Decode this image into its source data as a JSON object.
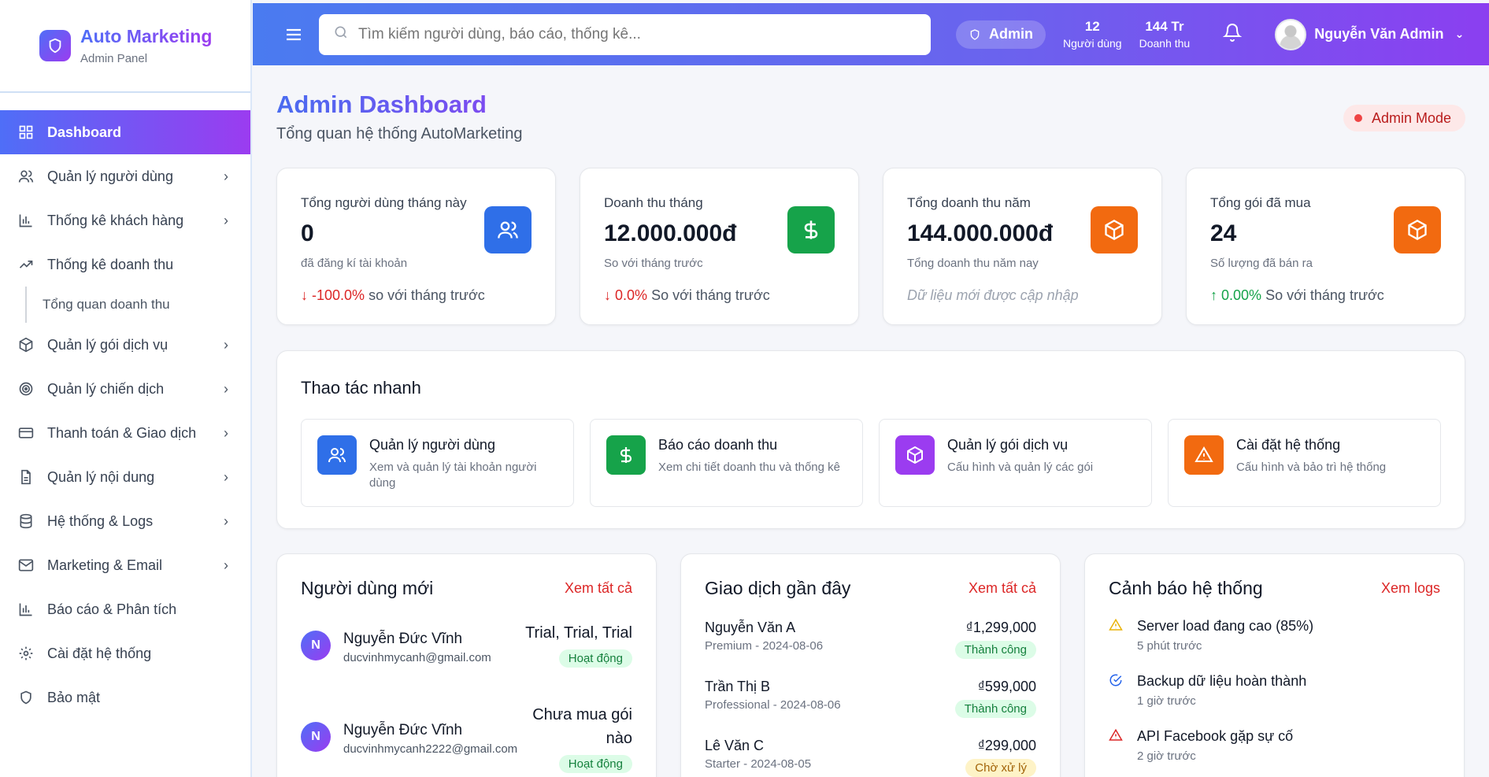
{
  "brand": {
    "title": "Auto Marketing",
    "subtitle": "Admin Panel"
  },
  "sidebar": {
    "items": [
      {
        "label": "Dashboard",
        "icon": "dashboard-icon",
        "active": true
      },
      {
        "label": "Quản lý người dùng",
        "icon": "users-icon"
      },
      {
        "label": "Thống kê khách hàng",
        "icon": "bar-chart-icon"
      },
      {
        "label": "Thống kê doanh thu",
        "icon": "trending-up-icon"
      },
      {
        "label": "Tổng quan doanh thu"
      },
      {
        "label": "Quản lý gói dịch vụ",
        "icon": "package-icon"
      },
      {
        "label": "Quản lý chiến dịch",
        "icon": "target-icon"
      },
      {
        "label": "Thanh toán & Giao dịch",
        "icon": "credit-card-icon"
      },
      {
        "label": "Quản lý nội dung",
        "icon": "document-icon"
      },
      {
        "label": "Hệ thống & Logs",
        "icon": "database-icon"
      },
      {
        "label": "Marketing & Email",
        "icon": "mail-icon"
      },
      {
        "label": "Báo cáo & Phân tích",
        "icon": "bar-chart-icon"
      },
      {
        "label": "Cài đặt hệ thống",
        "icon": "gear-icon"
      },
      {
        "label": "Bảo mật",
        "icon": "shield-icon"
      }
    ]
  },
  "topbar": {
    "search_placeholder": "Tìm kiếm người dùng, báo cáo, thống kê...",
    "role": "Admin",
    "users_value": "12",
    "users_label": "Người dùng",
    "revenue_value": "144 Tr",
    "revenue_label": "Doanh thu",
    "user_name": "Nguyễn Văn Admin"
  },
  "page": {
    "title": "Admin Dashboard",
    "subtitle": "Tổng quan hệ thống AutoMarketing",
    "mode": "Admin Mode"
  },
  "stats": [
    {
      "title": "Tổng người dùng tháng này",
      "value": "0",
      "sub": "đã đăng kí tài khoản",
      "change": "-100.0%",
      "change_text": "so với tháng trước",
      "icon": "users-icon"
    },
    {
      "title": "Doanh thu tháng",
      "value": "12.000.000đ",
      "sub": "So với tháng trước",
      "change": "0.0%",
      "change_text": "So với tháng trước",
      "icon": "dollar-icon"
    },
    {
      "title": "Tổng doanh thu năm",
      "value": "144.000.000đ",
      "sub": "Tổng doanh thu năm nay",
      "note": "Dữ liệu mới được cập nhập",
      "icon": "package-icon"
    },
    {
      "title": "Tổng gói đã mua",
      "value": "24",
      "sub": "Số lượng đã bán ra",
      "change": "0.00%",
      "change_text": "So với tháng trước",
      "icon": "package-icon"
    }
  ],
  "quick": {
    "title": "Thao tác nhanh",
    "items": [
      {
        "title": "Quản lý người dùng",
        "desc": "Xem và quản lý tài khoản người dùng",
        "icon": "users-icon"
      },
      {
        "title": "Báo cáo doanh thu",
        "desc": "Xem chi tiết doanh thu và thống kê",
        "icon": "dollar-icon"
      },
      {
        "title": "Quản lý gói dịch vụ",
        "desc": "Cấu hình và quản lý các gói",
        "icon": "package-icon"
      },
      {
        "title": "Cài đặt hệ thống",
        "desc": "Cấu hình và bảo trì hệ thống",
        "icon": "warning-icon"
      }
    ]
  },
  "new_users": {
    "title": "Người dùng mới",
    "link": "Xem tất cả",
    "rows": [
      {
        "initial": "N",
        "name": "Nguyễn Đức Vĩnh",
        "email": "ducvinhmycanh@gmail.com",
        "plan": "Trial, Trial, Trial",
        "status": "Hoạt động"
      },
      {
        "initial": "N",
        "name": "Nguyễn Đức Vĩnh",
        "email": "ducvinhmycanh2222@gmail.com",
        "plan": "Chưa mua gói nào",
        "status": "Hoạt động"
      }
    ]
  },
  "transactions": {
    "title": "Giao dịch gần đây",
    "link": "Xem tất cả",
    "rows": [
      {
        "name": "Nguyễn Văn A",
        "detail": "Premium - 2024-08-06",
        "amount": "₫1,299,000",
        "status": "Thành công"
      },
      {
        "name": "Trần Thị B",
        "detail": "Professional - 2024-08-06",
        "amount": "₫599,000",
        "status": "Thành công"
      },
      {
        "name": "Lê Văn C",
        "detail": "Starter - 2024-08-05",
        "amount": "₫299,000",
        "status": "Chờ xử lý"
      }
    ]
  },
  "alerts": {
    "title": "Cảnh báo hệ thống",
    "link": "Xem logs",
    "rows": [
      {
        "message": "Server load đang cao (85%)",
        "time": "5 phút trước",
        "icon": "warning-icon"
      },
      {
        "message": "Backup dữ liệu hoàn thành",
        "time": "1 giờ trước",
        "icon": "check-circle-icon"
      },
      {
        "message": "API Facebook gặp sự cố",
        "time": "2 giờ trước",
        "icon": "alert-icon"
      }
    ]
  }
}
